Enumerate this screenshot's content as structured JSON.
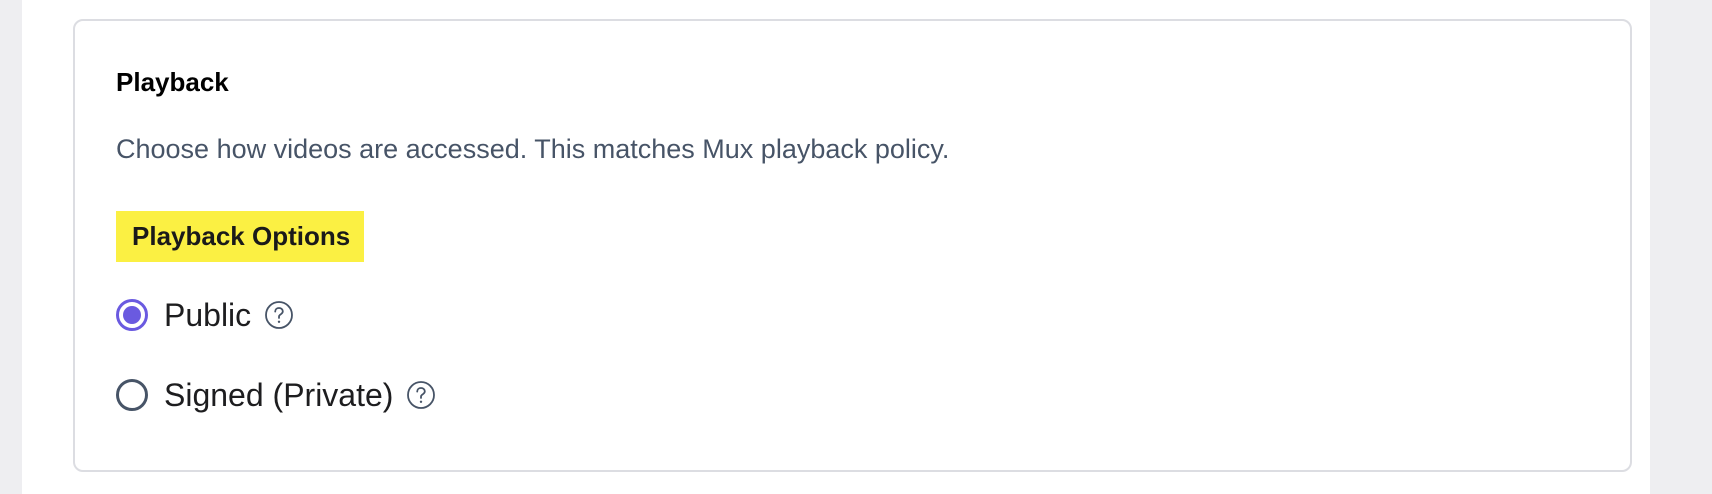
{
  "section": {
    "title": "Playback",
    "description": "Choose how videos are accessed. This matches Mux playback policy."
  },
  "playback_options": {
    "label": "Playback Options",
    "selected": "Public",
    "options": [
      {
        "label": "Public",
        "checked": true,
        "help_icon": "question-circle-icon"
      },
      {
        "label": "Signed (Private)",
        "checked": false,
        "help_icon": "question-circle-icon"
      }
    ]
  },
  "colors": {
    "accent": "#6a5ae0",
    "highlight": "#fbf043",
    "description_text": "#475467",
    "card_border": "#dcdde2"
  }
}
